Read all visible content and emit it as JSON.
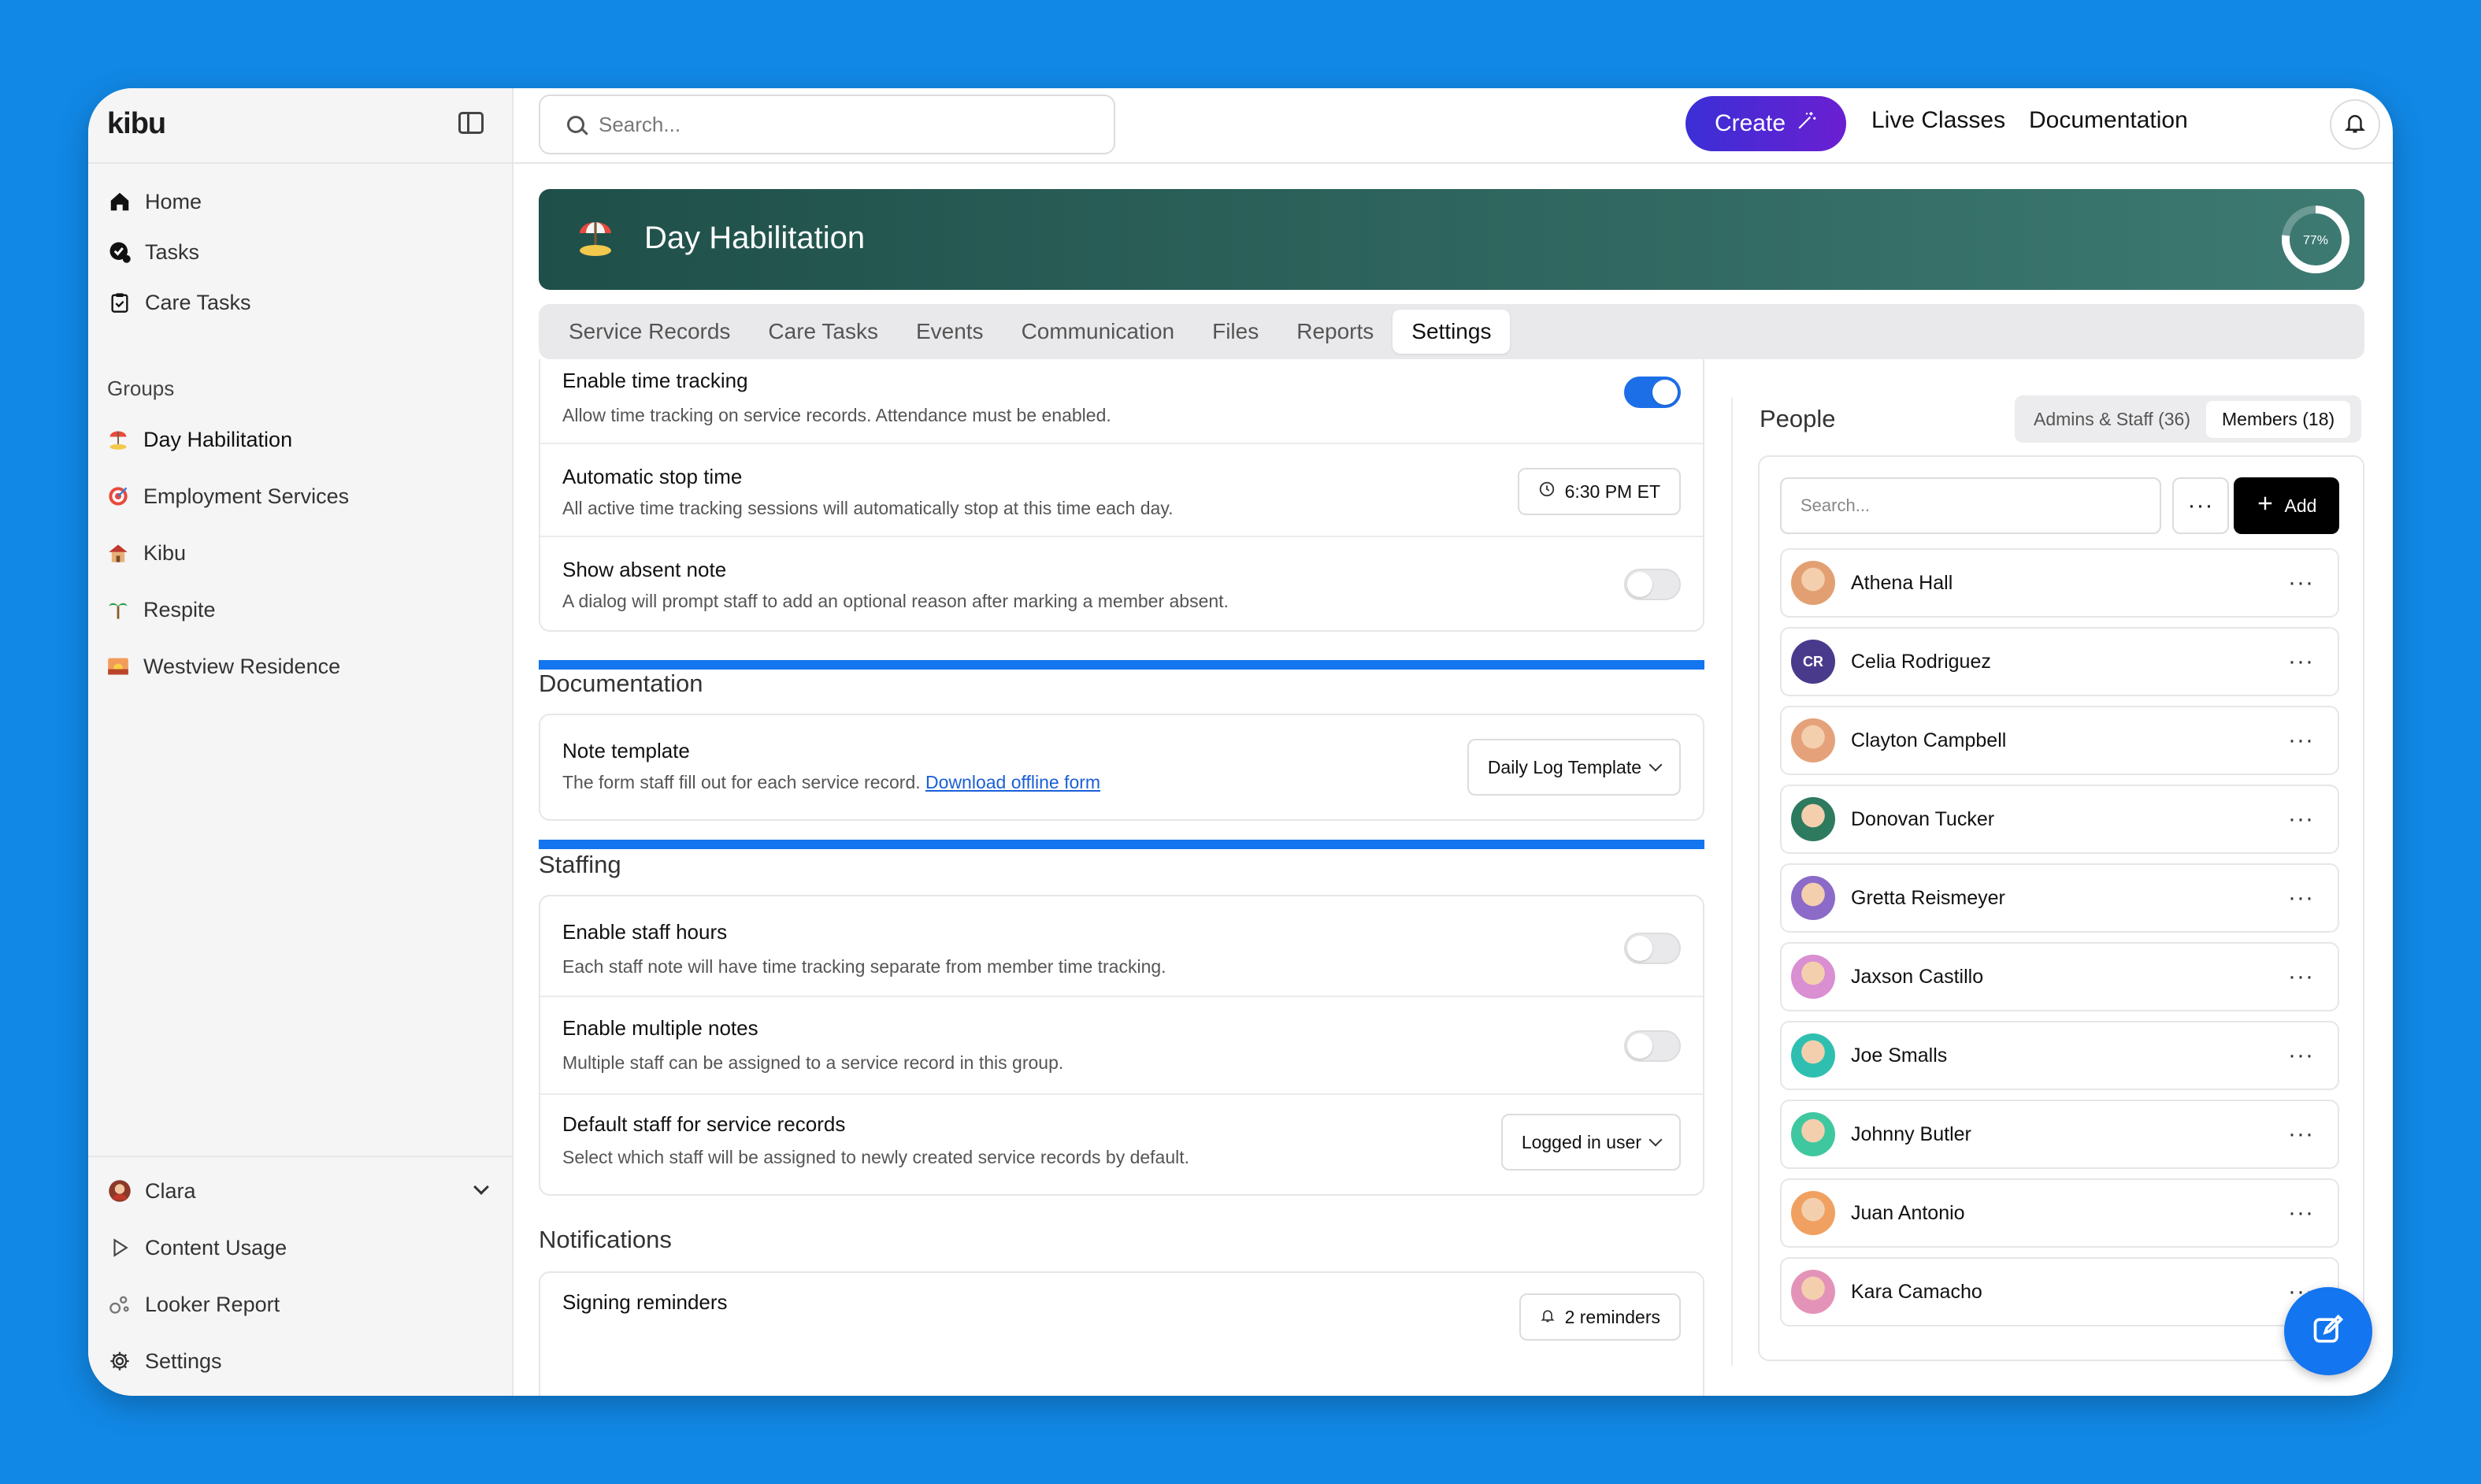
{
  "app": {
    "logo": "kibu"
  },
  "sidebar": {
    "nav": [
      {
        "label": "Home",
        "icon": "home-icon"
      },
      {
        "label": "Tasks",
        "icon": "tasks-icon"
      },
      {
        "label": "Care Tasks",
        "icon": "clipboard-icon"
      }
    ],
    "groups_heading": "Groups",
    "groups": [
      {
        "label": "Day Habilitation",
        "icon": "beach-icon"
      },
      {
        "label": "Employment Services",
        "icon": "target-icon"
      },
      {
        "label": "Kibu",
        "icon": "house-icon"
      },
      {
        "label": "Respite",
        "icon": "palm-tree-icon"
      },
      {
        "label": "Westview Residence",
        "icon": "sunset-icon"
      }
    ],
    "user": "Clara",
    "bottom": [
      {
        "label": "Content Usage",
        "icon": "play-icon"
      },
      {
        "label": "Looker Report",
        "icon": "looker-icon"
      },
      {
        "label": "Settings",
        "icon": "gear-icon"
      }
    ]
  },
  "topbar": {
    "search_placeholder": "Search...",
    "create_label": "Create",
    "links": [
      "Live Classes",
      "Documentation"
    ]
  },
  "banner": {
    "title": "Day Habilitation",
    "progress_label": "77%",
    "progress": 0.77
  },
  "tabs": [
    "Service Records",
    "Care Tasks",
    "Events",
    "Communication",
    "Files",
    "Reports",
    "Settings"
  ],
  "active_tab": "Settings",
  "settings": {
    "attendance_rows": [
      {
        "title": "Enable time tracking",
        "desc": "Allow time tracking on service records. Attendance must be enabled.",
        "toggle": true
      },
      {
        "title": "Automatic stop time",
        "desc": "All active time tracking sessions will automatically stop at this time each day.",
        "button": "6:30 PM ET"
      },
      {
        "title": "Show absent note",
        "desc": "A dialog will prompt staff to add an optional reason after marking a member absent.",
        "toggle": false
      }
    ],
    "documentation": {
      "heading": "Documentation",
      "row": {
        "title": "Note template",
        "desc": "The form staff fill out for each service record.",
        "link": "Download offline form",
        "button": "Daily Log Template"
      }
    },
    "staffing": {
      "heading": "Staffing",
      "rows": [
        {
          "title": "Enable staff hours",
          "desc": "Each staff note will have time tracking separate from member time tracking.",
          "toggle": false
        },
        {
          "title": "Enable multiple notes",
          "desc": "Multiple staff can be assigned to a service record in this group.",
          "toggle": false
        },
        {
          "title": "Default staff for service records",
          "desc": "Select which staff will be assigned to newly created service records by default.",
          "button": "Logged in user"
        }
      ]
    },
    "notifications": {
      "heading": "Notifications",
      "row": {
        "title": "Signing reminders",
        "button": "2 reminders"
      }
    }
  },
  "people": {
    "heading": "People",
    "tabs": [
      "Admins & Staff (36)",
      "Members (18)"
    ],
    "active_tab": "Members (18)",
    "search_placeholder": "Search...",
    "add_label": "Add",
    "list": [
      {
        "name": "Athena Hall",
        "color": "#e2a072"
      },
      {
        "name": "Celia Rodriguez",
        "initials": "CR",
        "color": "#4a3a8c"
      },
      {
        "name": "Clayton Campbell",
        "color": "#e5a27a"
      },
      {
        "name": "Donovan Tucker",
        "color": "#2d7a5f"
      },
      {
        "name": "Gretta Reismeyer",
        "color": "#8c6ac8"
      },
      {
        "name": "Jaxson Castillo",
        "color": "#d98fd2"
      },
      {
        "name": "Joe Smalls",
        "color": "#2fbfb0"
      },
      {
        "name": "Johnny Butler",
        "color": "#3fc7a0"
      },
      {
        "name": "Juan Antonio",
        "color": "#f0a060"
      },
      {
        "name": "Kara Camacho",
        "color": "#e493b8"
      }
    ]
  }
}
